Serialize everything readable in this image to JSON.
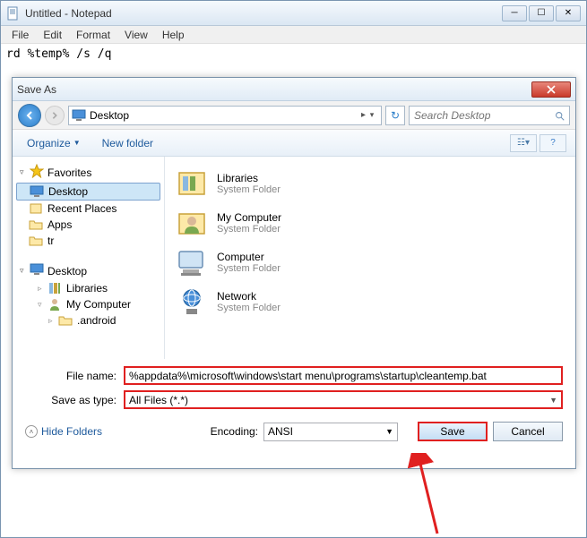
{
  "notepad": {
    "title": "Untitled - Notepad",
    "menu": {
      "file": "File",
      "edit": "Edit",
      "format": "Format",
      "view": "View",
      "help": "Help"
    },
    "content": "rd %temp% /s /q"
  },
  "saveas": {
    "title": "Save As",
    "path": "Desktop",
    "path_chevron": "▸",
    "search_placeholder": "Search Desktop",
    "organize": "Organize",
    "newfolder": "New folder",
    "nav": {
      "favorites": "Favorites",
      "items_fav": [
        "Desktop",
        "Recent Places",
        "Apps",
        "tr"
      ],
      "desktop": "Desktop",
      "items_desk": [
        "Libraries",
        "My Computer",
        ".android"
      ]
    },
    "files": [
      {
        "name": "Libraries",
        "sub": "System Folder"
      },
      {
        "name": "My Computer",
        "sub": "System Folder"
      },
      {
        "name": "Computer",
        "sub": "System Folder"
      },
      {
        "name": "Network",
        "sub": "System Folder"
      }
    ],
    "filename_label": "File name:",
    "filename_value": "%appdata%\\microsoft\\windows\\start menu\\programs\\startup\\cleantemp.bat",
    "saveastype_label": "Save as type:",
    "saveastype_value": "All Files (*.*)",
    "hidefolders": "Hide Folders",
    "encoding_label": "Encoding:",
    "encoding_value": "ANSI",
    "save": "Save",
    "cancel": "Cancel"
  }
}
